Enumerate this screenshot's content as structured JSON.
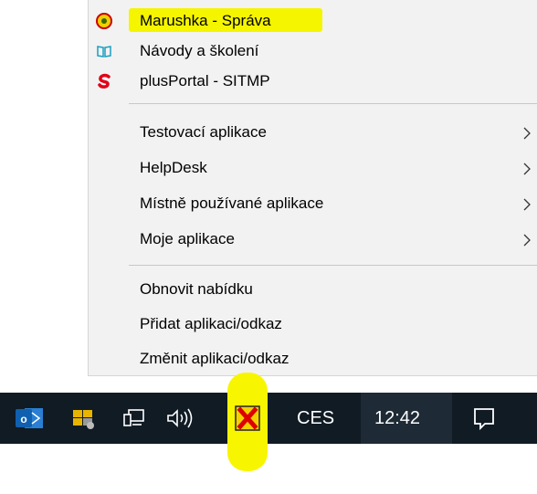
{
  "menu": {
    "items": [
      {
        "label": "Marushka - Správa",
        "icon": "marushka-icon",
        "highlighted": true
      },
      {
        "label": "Návody a školení",
        "icon": "book-icon"
      },
      {
        "label": "plusPortal - SITMP",
        "icon": "plusportal-icon"
      },
      {
        "label": "Testovací aplikace",
        "submenu": true
      },
      {
        "label": "HelpDesk",
        "submenu": true
      },
      {
        "label": "Místně používané aplikace",
        "submenu": true
      },
      {
        "label": "Moje aplikace",
        "submenu": true
      },
      {
        "label": "Obnovit nabídku"
      },
      {
        "label": "Přidat aplikaci/odkaz"
      },
      {
        "label": "Změnit aplikaci/odkaz"
      }
    ],
    "highlight_color": "#f5f500"
  },
  "taskbar": {
    "icons": [
      "outlook-icon",
      "app-tray-icon",
      "network-icon",
      "volume-icon",
      "red-x-app-icon",
      "notification-icon"
    ],
    "language": "CES",
    "clock": "12:42",
    "background": "#101b24"
  }
}
